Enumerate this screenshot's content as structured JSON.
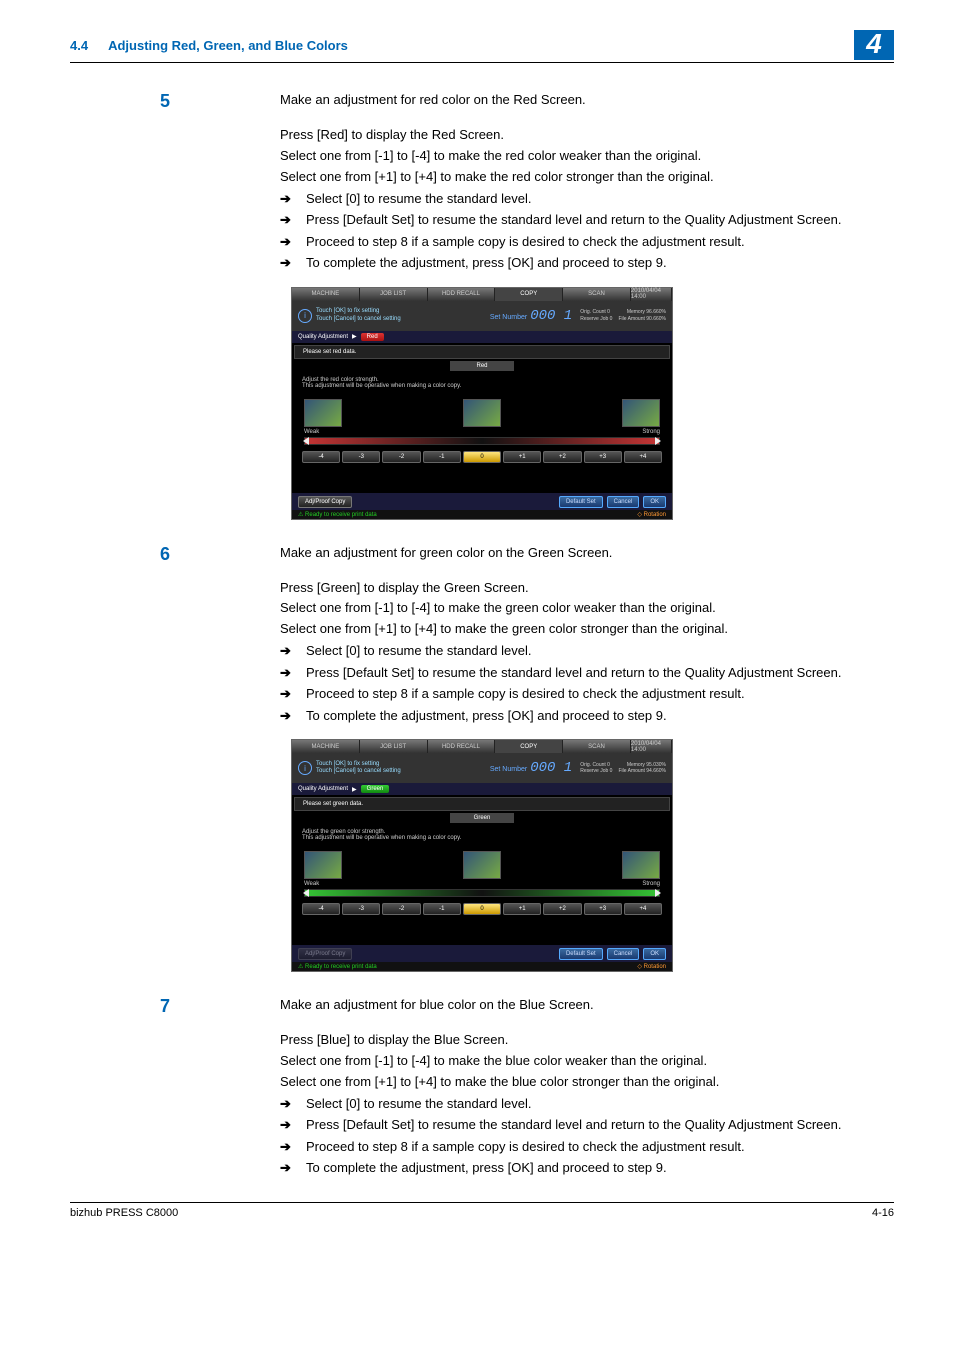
{
  "header": {
    "section_num": "4.4",
    "section_title": "Adjusting Red, Green, and Blue Colors",
    "chapter": "4"
  },
  "steps": [
    {
      "num": "5",
      "intro": "Make an adjustment for red color on the Red Screen.",
      "lines": [
        "Press [Red] to display the Red Screen.",
        "Select one from [-1] to [-4] to make the red color weaker than the original.",
        "Select one from [+1] to [+4] to make the red color stronger than the original."
      ],
      "arrows": [
        "Select [0] to resume the standard level.",
        "Press [Default Set] to resume the standard level and return to the Quality Adjustment Screen.",
        "Proceed to step 8 if a sample copy is desired to check the adjustment result.",
        "To complete the adjustment, press [OK] and proceed to step 9."
      ]
    },
    {
      "num": "6",
      "intro": "Make an adjustment for green color on the Green Screen.",
      "lines": [
        "Press [Green] to display the Green Screen.",
        "Select one from [-1] to [-4] to make the green color weaker than the original.",
        "Select one from [+1] to [+4] to make the green color stronger than the original."
      ],
      "arrows": [
        "Select [0] to resume the standard level.",
        "Press [Default Set] to resume the standard level and return to the Quality Adjustment Screen.",
        "Proceed to step 8 if a sample copy is desired to check the adjustment result.",
        "To complete the adjustment, press [OK] and proceed to step 9."
      ]
    },
    {
      "num": "7",
      "intro": "Make an adjustment for blue color on the Blue Screen.",
      "lines": [
        "Press [Blue] to display the Blue Screen.",
        "Select one from [-1] to [-4] to make the blue color weaker than the original.",
        "Select one from [+1] to [+4] to make the blue color stronger than the original."
      ],
      "arrows": [
        "Select [0] to resume the standard level.",
        "Press [Default Set] to resume the standard level and return to the Quality Adjustment Screen.",
        "Proceed to step 8 if a sample copy is desired to check the adjustment result.",
        "To complete the adjustment, press [OK] and proceed to step 9."
      ]
    }
  ],
  "screens": [
    {
      "datetime": "2010/04/04 14:00",
      "tabs": [
        "MACHINE",
        "JOB LIST",
        "HDD RECALL",
        "COPY",
        "SCAN"
      ],
      "msg1": "Touch [OK] to fix setting",
      "msg2": "Touch [Cancel] to cancel setting",
      "setnum_label": "Set Number",
      "setnum": "000 1",
      "orig": "Orig. Count    0",
      "reserve": "Reserve Job    0",
      "mem": "Memory   96.660%",
      "file": "File Amount   90.660%",
      "breadcrumb": "Quality Adjustment",
      "chip": "Red",
      "subtitle": "Please set red data.",
      "tab_label": "Red",
      "desc1": "Adjust the red color strength.",
      "desc2": "This adjustment will be operative when making a color copy.",
      "weak": "Weak",
      "strong": "Strong",
      "levels": [
        "-4",
        "-3",
        "-2",
        "-1",
        "0",
        "+1",
        "+2",
        "+3",
        "+4"
      ],
      "proof": "Adj/Proof Copy",
      "default": "Default Set",
      "cancel": "Cancel",
      "ok": "OK",
      "status": "Ready to receive print data",
      "rot": "Rotation"
    },
    {
      "datetime": "2010/04/04 14:00",
      "tabs": [
        "MACHINE",
        "JOB LIST",
        "HDD RECALL",
        "COPY",
        "SCAN"
      ],
      "msg1": "Touch [OK] to fix setting",
      "msg2": "Touch [Cancel] to cancel setting",
      "setnum_label": "Set Number",
      "setnum": "000 1",
      "orig": "Orig. Count    0",
      "reserve": "Reserve Job    0",
      "mem": "Memory   95.030%",
      "file": "File Amount   94.660%",
      "breadcrumb": "Quality Adjustment",
      "chip": "Green",
      "subtitle": "Please set green data.",
      "tab_label": "Green",
      "desc1": "Adjust the green color strength.",
      "desc2": "This adjustment will be operative when making a color copy.",
      "weak": "Weak",
      "strong": "Strong",
      "levels": [
        "-4",
        "-3",
        "-2",
        "-1",
        "0",
        "+1",
        "+2",
        "+3",
        "+4"
      ],
      "proof": "Adj/Proof Copy",
      "default": "Default Set",
      "cancel": "Cancel",
      "ok": "OK",
      "status": "Ready to receive print data",
      "rot": "Rotation"
    }
  ],
  "footer": {
    "product": "bizhub PRESS C8000",
    "page": "4-16"
  }
}
